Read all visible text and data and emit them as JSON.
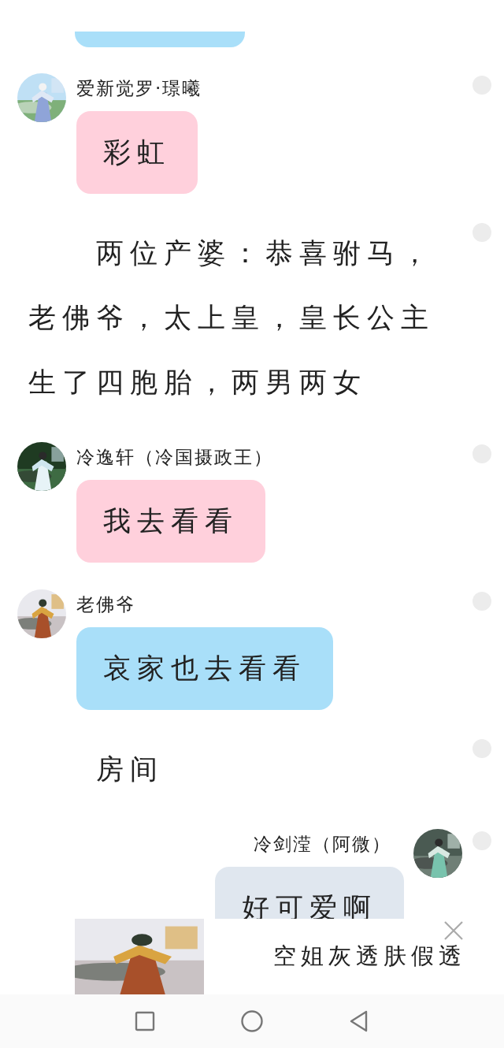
{
  "messages": [
    {
      "kind": "partial",
      "color": "#a9dff9"
    },
    {
      "kind": "left",
      "name": "爱新觉罗·璟曦",
      "text": "彩虹",
      "color": "#ffd0dc"
    },
    {
      "kind": "narration",
      "text": "两位产婆：恭喜驸马，老佛爷，太上皇，皇长公主生了四胞胎，两男两女"
    },
    {
      "kind": "left",
      "name": "冷逸轩（冷国摄政王）",
      "text": "我去看看",
      "color": "#ffd0dc"
    },
    {
      "kind": "left",
      "name": "老佛爷",
      "text": "哀家也去看看",
      "color": "#a9dff9"
    },
    {
      "kind": "narration",
      "text": "房间"
    },
    {
      "kind": "right",
      "name": "冷剑滢（阿微）",
      "text": "好可爱啊",
      "color": "#e0e7ef"
    }
  ],
  "ad": {
    "title": "空姐灰透肤假透"
  }
}
